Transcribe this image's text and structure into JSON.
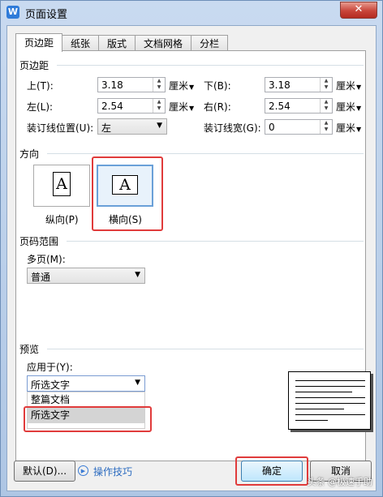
{
  "window": {
    "title": "页面设置",
    "app_icon": "W",
    "close_symbol": "✕"
  },
  "tabs": [
    {
      "label": "页边距",
      "active": true
    },
    {
      "label": "纸张"
    },
    {
      "label": "版式"
    },
    {
      "label": "文档网格"
    },
    {
      "label": "分栏"
    }
  ],
  "margins": {
    "section_title": "页边距",
    "top_label": "上(T):",
    "top_value": "3.18",
    "bottom_label": "下(B):",
    "bottom_value": "3.18",
    "left_label": "左(L):",
    "left_value": "2.54",
    "right_label": "右(R):",
    "right_value": "2.54",
    "gutter_pos_label": "装订线位置(U):",
    "gutter_pos_value": "左",
    "gutter_width_label": "装订线宽(G):",
    "gutter_width_value": "0",
    "unit": "厘米"
  },
  "orientation": {
    "section_title": "方向",
    "portrait_label": "纵向(P)",
    "landscape_label": "横向(S)",
    "glyph": "A",
    "selected": "landscape"
  },
  "page_range": {
    "section_title": "页码范围",
    "multi_label": "多页(M):",
    "multi_value": "普通"
  },
  "preview": {
    "section_title": "预览",
    "apply_label": "应用于(Y):",
    "apply_value": "所选文字",
    "options": [
      "整篇文档",
      "所选文字"
    ],
    "highlighted_option": "所选文字"
  },
  "buttons": {
    "default": "默认(D)...",
    "tips": "操作技巧",
    "ok": "确定",
    "cancel": "取消"
  },
  "watermark": "头条 @极速手助",
  "colors": {
    "highlight": "#e03b3b",
    "link": "#2d6cc0",
    "selection": "#6aa0d8"
  }
}
